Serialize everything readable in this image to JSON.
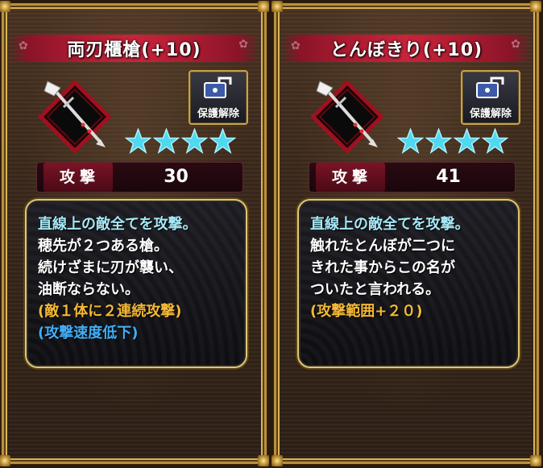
{
  "cards": [
    {
      "name": "両刃櫃槍(+10)",
      "unlock_label": "保護解除",
      "star_count": 4,
      "attack_label": "攻撃",
      "attack_value": "30",
      "description": [
        {
          "text": "直線上の敵全てを攻撃。",
          "style": "cyan"
        },
        {
          "text": "穂先が２つある槍。",
          "style": "white"
        },
        {
          "text": "続けざまに刃が襲い、",
          "style": "white"
        },
        {
          "text": "油断ならない。",
          "style": "white"
        },
        {
          "text": "(敵１体に２連続攻撃)",
          "style": "gold"
        },
        {
          "text": "(攻撃速度低下)",
          "style": "blue"
        }
      ]
    },
    {
      "name": "とんぼきり(+10)",
      "unlock_label": "保護解除",
      "star_count": 4,
      "attack_label": "攻撃",
      "attack_value": "41",
      "description": [
        {
          "text": "直線上の敵全てを攻撃。",
          "style": "cyan"
        },
        {
          "text": "触れたとんぼが二つに",
          "style": "white"
        },
        {
          "text": "きれた事からこの名が",
          "style": "white"
        },
        {
          "text": "ついたと言われる。",
          "style": "white"
        },
        {
          "text": "(攻撃範囲+２０)",
          "style": "gold"
        }
      ]
    }
  ],
  "colors": {
    "frame_gold": "#b8913e",
    "title_red": "#c8243c",
    "star_cyan": "#4fd8f0",
    "text_cyan": "#a6e8f4",
    "text_gold": "#f5b935",
    "text_blue": "#41aef5"
  },
  "icons": {
    "weapon": "spear-icon",
    "unlock": "lock-icon",
    "rating": "star-icon"
  }
}
